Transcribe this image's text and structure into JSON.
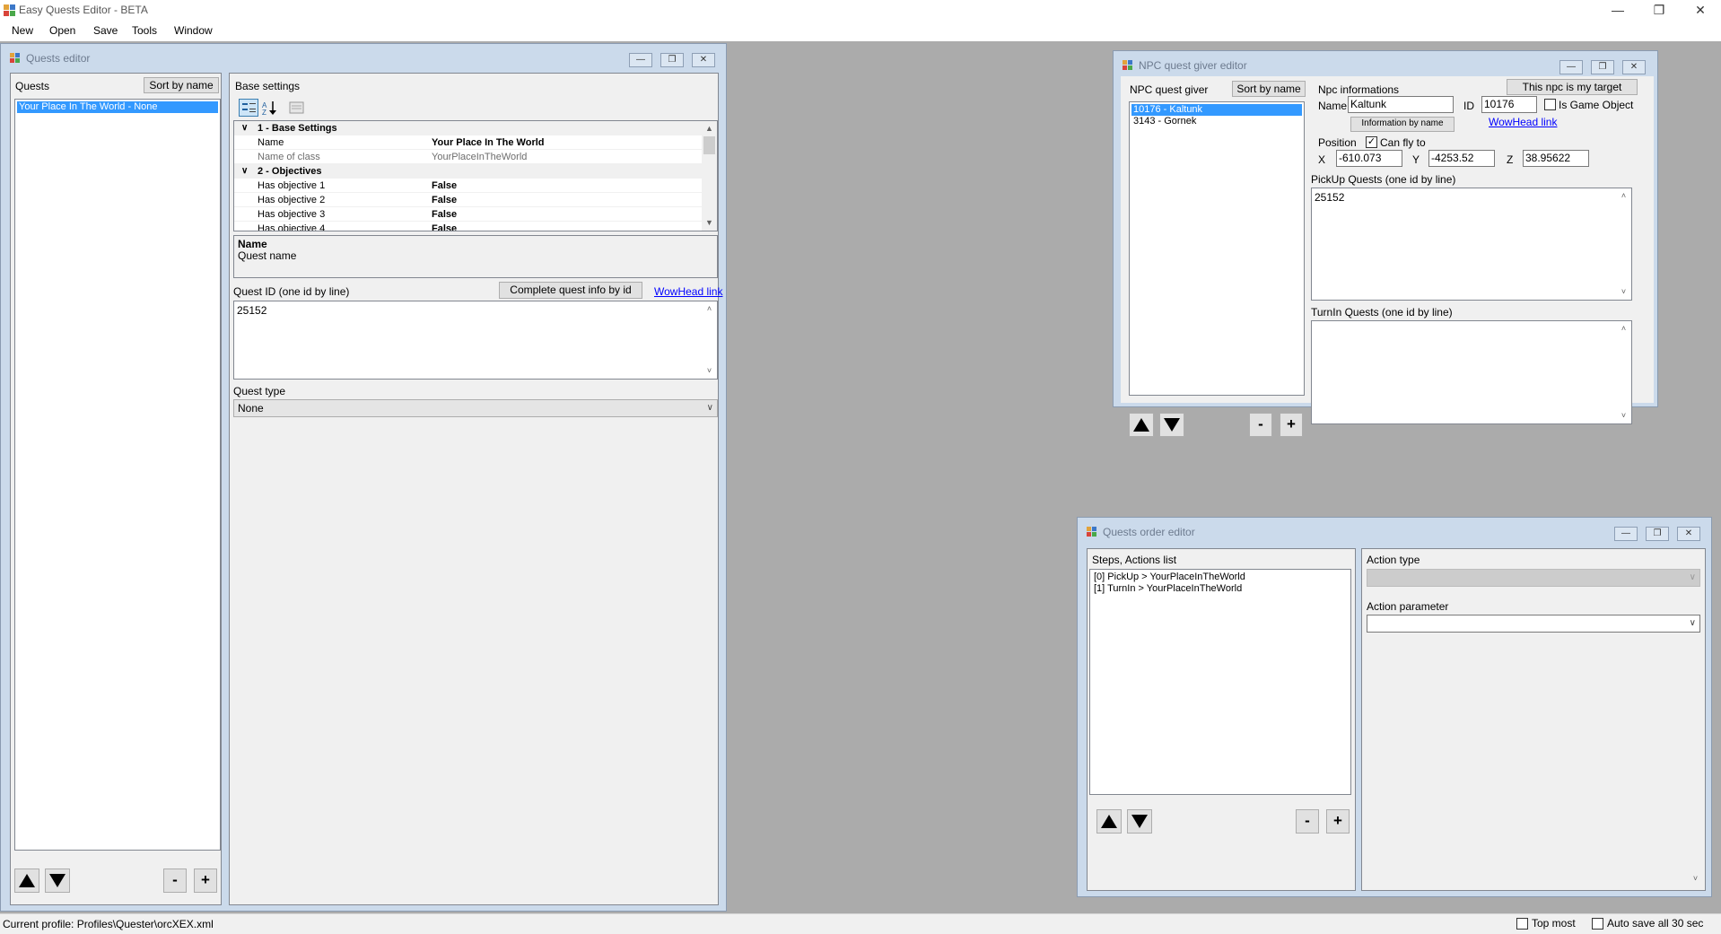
{
  "app": {
    "title": "Easy Quests Editor - BETA"
  },
  "menu": [
    "New",
    "Open",
    "Save",
    "Tools",
    "Window"
  ],
  "quests_editor": {
    "title": "Quests editor",
    "quests_label": "Quests",
    "sort_button": "Sort by name",
    "quests": [
      "Your Place In The World - None"
    ],
    "base_settings_label": "Base settings",
    "grid": [
      {
        "kind": "category",
        "name": "1 - Base Settings"
      },
      {
        "kind": "prop",
        "name": "Name",
        "value": "Your Place In The World",
        "bold": true
      },
      {
        "kind": "prop",
        "name": "Name of class",
        "value": "YourPlaceInTheWorld",
        "gray": true
      },
      {
        "kind": "category",
        "name": "2 - Objectives"
      },
      {
        "kind": "prop",
        "name": "Has objective 1",
        "value": "False",
        "bold": true
      },
      {
        "kind": "prop",
        "name": "Has objective 2",
        "value": "False",
        "bold": true
      },
      {
        "kind": "prop",
        "name": "Has objective 3",
        "value": "False",
        "bold": true
      },
      {
        "kind": "prop",
        "name": "Has objective 4",
        "value": "False",
        "bold": true
      }
    ],
    "help_title": "Name",
    "help_text": "Quest name",
    "quest_id_label": "Quest ID (one id by line)",
    "complete_button": "Complete quest info by id",
    "wowhead_link": "WowHead link",
    "quest_ids": "25152",
    "quest_type_label": "Quest type",
    "quest_type": "None",
    "minus": "-",
    "plus": "+"
  },
  "npc_editor": {
    "title": "NPC quest giver editor",
    "list_label": "NPC quest giver",
    "sort_button": "Sort by name",
    "npcs": [
      "10176 - Kaltunk",
      "3143 - Gornek"
    ],
    "info_label": "Npc informations",
    "target_button": "This npc is my target",
    "name_label": "Name",
    "name_value": "Kaltunk",
    "id_label": "ID",
    "id_value": "10176",
    "is_game_object": "Is Game Object",
    "info_by_name_button": "Information by name",
    "wowhead_link": "WowHead link",
    "position_label": "Position",
    "can_fly": "Can fly to",
    "x_label": "X",
    "x_value": "-610.073",
    "y_label": "Y",
    "y_value": "-4253.52",
    "z_label": "Z",
    "z_value": "38.95622",
    "pickup_label": "PickUp Quests (one id by line)",
    "pickup_value": "25152",
    "turnin_label": "TurnIn Quests (one id by line)",
    "turnin_value": "",
    "minus": "-",
    "plus": "+"
  },
  "order_editor": {
    "title": "Quests order editor",
    "steps_label": "Steps, Actions list",
    "steps": [
      "[0] PickUp > YourPlaceInTheWorld",
      "[1] TurnIn > YourPlaceInTheWorld"
    ],
    "action_type_label": "Action type",
    "action_param_label": "Action parameter",
    "minus": "-",
    "plus": "+"
  },
  "status": {
    "profile": "Current profile: Profiles\\Quester\\orcXEX.xml",
    "top_most": "Top most",
    "auto_save": "Auto save all 30 sec"
  },
  "colors": {
    "mdi_background": "#ababab",
    "child_frame": "#cbdaeb",
    "selection": "#3399ff",
    "link": "#0000ff"
  },
  "icons": [
    "app-icon",
    "minimize-icon",
    "restore-icon",
    "close-icon",
    "arrow-up-icon",
    "arrow-down-icon",
    "categorized-icon",
    "alphabetical-icon",
    "property-pages-icon"
  ]
}
